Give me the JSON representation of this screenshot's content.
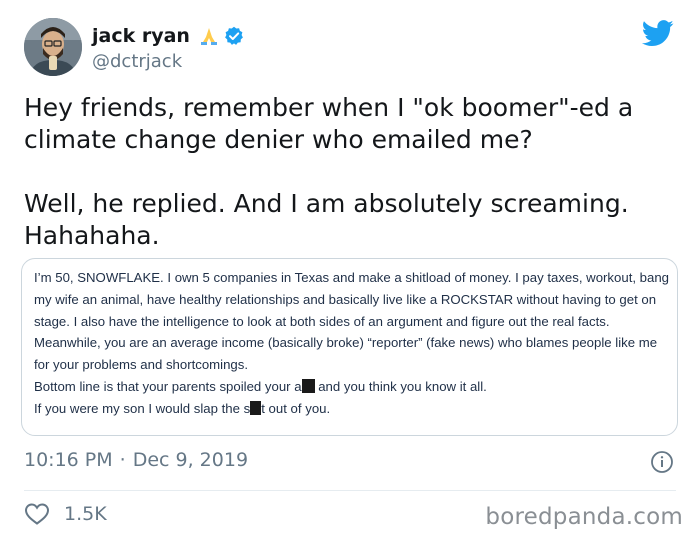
{
  "user": {
    "name": "jack ryan",
    "handle": "@dctrjack",
    "name_emoji": "folded-hands-emoji",
    "verified_icon": "verified-badge-icon"
  },
  "tweet": {
    "lines": [
      "Hey friends, remember when I \"ok boomer\"-ed a",
      "climate change denier who emailed me?",
      "Well, he replied. And I am absolutely screaming.",
      "Hahahaha."
    ]
  },
  "email": {
    "lines": [
      "I’m 50, SNOWFLAKE.  I own 5 companies in Texas and make a shitload of money.  I pay taxes, workout, bang",
      "my wife an animal, have healthy relationships and basically live like a ROCKSTAR without having to get on",
      "stage.  I also have the intelligence to look at both sides of an argument and figure out the real facts.",
      "Meanwhile, you are an average income (basically broke) “reporter” (fake news) who blames people like me",
      "for your problems and shortcomings."
    ],
    "line6_before": "Bottom line is that your parents spoiled your a",
    "line6_after": " and you think you know it all.",
    "line7_before": "If you were my son I would slap the s",
    "line7_after": "t out of you."
  },
  "meta": {
    "time": "10:16 PM",
    "separator": "·",
    "date": "Dec 9, 2019"
  },
  "engagement": {
    "likes": "1.5K"
  },
  "watermark": "boredpanda.com",
  "colors": {
    "twitter_blue": "#1da1f2",
    "text": "#14171a",
    "muted": "#657786",
    "email_text": "#1f2f47",
    "border": "#ccd6dd"
  },
  "icons": {
    "brand": "twitter-bird-icon",
    "info": "info-icon",
    "like": "heart-icon"
  }
}
